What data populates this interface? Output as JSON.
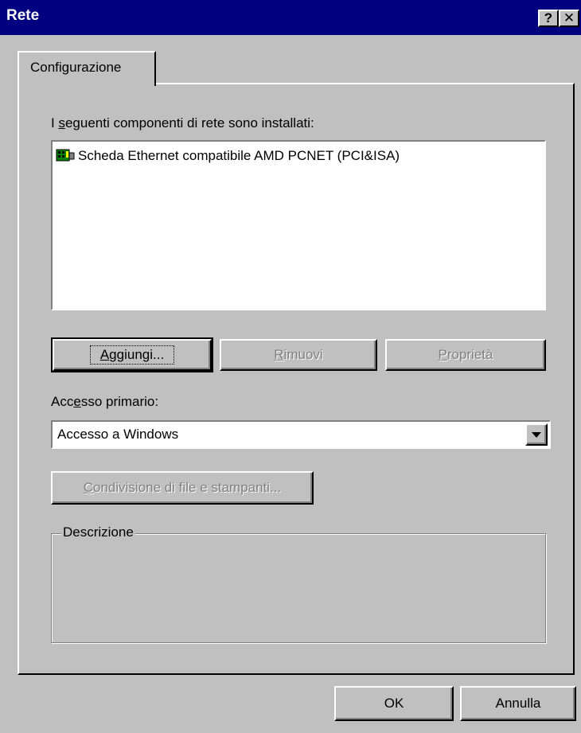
{
  "window": {
    "title": "Rete",
    "help_button": "?",
    "close_button": "✕"
  },
  "tabs": [
    {
      "label": "Configurazione"
    }
  ],
  "components": {
    "label_pre": "I ",
    "label_access_key": "s",
    "label_post": "eguenti componenti di rete sono installati:",
    "items": [
      {
        "label": "Scheda Ethernet compatibile AMD PCNET (PCI&ISA)",
        "icon": "network-adapter-icon"
      }
    ]
  },
  "buttons": {
    "add": {
      "key": "A",
      "rest": "ggiungi..."
    },
    "remove": {
      "key": "R",
      "rest": "imuovi"
    },
    "properties": {
      "key": "P",
      "rest": "roprietà"
    }
  },
  "primary_logon": {
    "label_pre": "Acc",
    "label_key": "e",
    "label_post": "sso primario:",
    "value": "Accesso a Windows"
  },
  "sharing_button": {
    "key": "C",
    "rest": "ondivisione di file e stampanti..."
  },
  "description": {
    "label": "Descrizione",
    "text": ""
  },
  "footer": {
    "ok": "OK",
    "cancel": "Annulla"
  },
  "colors": {
    "titlebar": "#000080",
    "face": "#c0c0c0",
    "disabled_text": "#808080"
  }
}
